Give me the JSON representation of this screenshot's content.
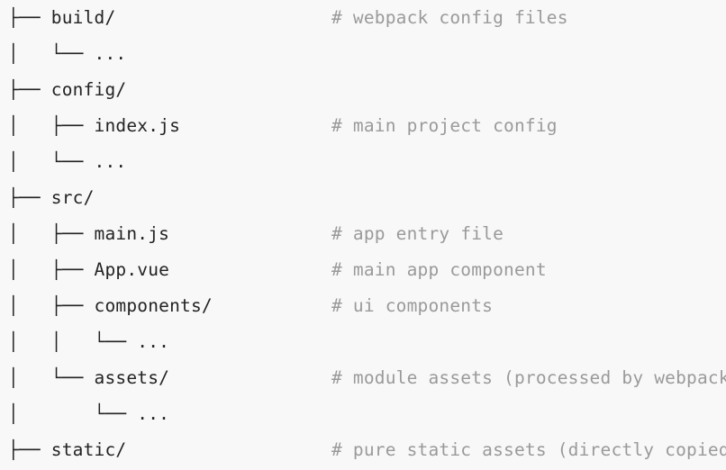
{
  "view": {
    "kind": "directory-tree-listing",
    "background_color": "#f8f8f8",
    "text_color": "#232323",
    "comment_color": "#9a9a9a"
  },
  "tree": {
    "rows": [
      {
        "branch": "├── ",
        "label": "build/",
        "comment": "# webpack config files"
      },
      {
        "branch": "│   └── ",
        "label": "...",
        "comment": ""
      },
      {
        "branch": "├── ",
        "label": "config/",
        "comment": ""
      },
      {
        "branch": "│   ├── ",
        "label": "index.js",
        "comment": "# main project config"
      },
      {
        "branch": "│   └── ",
        "label": "...",
        "comment": ""
      },
      {
        "branch": "├── ",
        "label": "src/",
        "comment": ""
      },
      {
        "branch": "│   ├── ",
        "label": "main.js",
        "comment": "# app entry file"
      },
      {
        "branch": "│   ├── ",
        "label": "App.vue",
        "comment": "# main app component"
      },
      {
        "branch": "│   ├── ",
        "label": "components/",
        "comment": "# ui components"
      },
      {
        "branch": "│   │   └── ",
        "label": "...",
        "comment": ""
      },
      {
        "branch": "│   └── ",
        "label": "assets/",
        "comment": "# module assets (processed by webpack)"
      },
      {
        "branch": "│       └── ",
        "label": "...",
        "comment": ""
      },
      {
        "branch": "├── ",
        "label": "static/",
        "comment": "# pure static assets (directly copied)"
      }
    ]
  }
}
